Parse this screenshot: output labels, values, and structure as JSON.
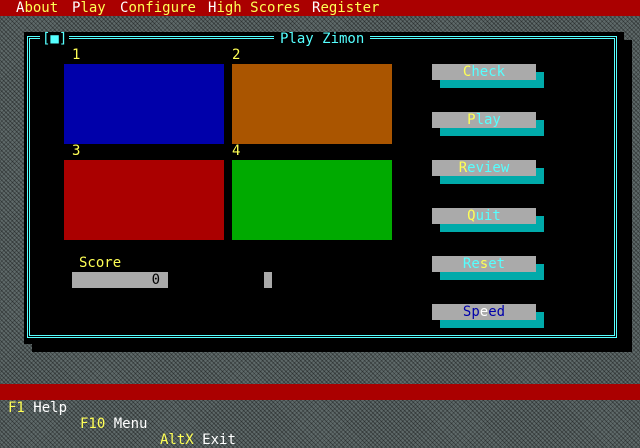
{
  "menubar": {
    "items": [
      {
        "hotkey": "A",
        "rest": "bout"
      },
      {
        "hotkey": "P",
        "rest": "lay"
      },
      {
        "hotkey": "C",
        "rest": "onfigure"
      },
      {
        "hotkey": "H",
        "rest": "igh Scores"
      },
      {
        "hotkey": "R",
        "rest": "egister"
      }
    ]
  },
  "window": {
    "title": "Play  Zimon",
    "close_box": "[■]"
  },
  "pads": [
    {
      "label": "1",
      "color": "#0000aa"
    },
    {
      "label": "2",
      "color": "#aa5500"
    },
    {
      "label": "3",
      "color": "#aa0000"
    },
    {
      "label": "4",
      "color": "#00aa00"
    }
  ],
  "score": {
    "label": "Score",
    "value": "0"
  },
  "buttons": [
    {
      "pre": "",
      "hot": "C",
      "post": "heck"
    },
    {
      "pre": "",
      "hot": "P",
      "post": "lay"
    },
    {
      "pre": "",
      "hot": "R",
      "post": "eview"
    },
    {
      "pre": "",
      "hot": "Q",
      "post": "uit"
    },
    {
      "pre": "Re",
      "hot": "s",
      "post": "et"
    },
    {
      "pre": "Sp",
      "hot": "e",
      "post": "ed"
    }
  ],
  "statusbar": [
    {
      "key": "F1",
      "label": "Help"
    },
    {
      "key": "F10",
      "label": "Menu"
    },
    {
      "key": "AltX",
      "label": "Exit"
    }
  ],
  "colors": {
    "menubar_bg": "#aa0000",
    "window_frame": "#55ffff",
    "button_face": "#aaaaaa",
    "button_shadow": "#00aaaa"
  }
}
